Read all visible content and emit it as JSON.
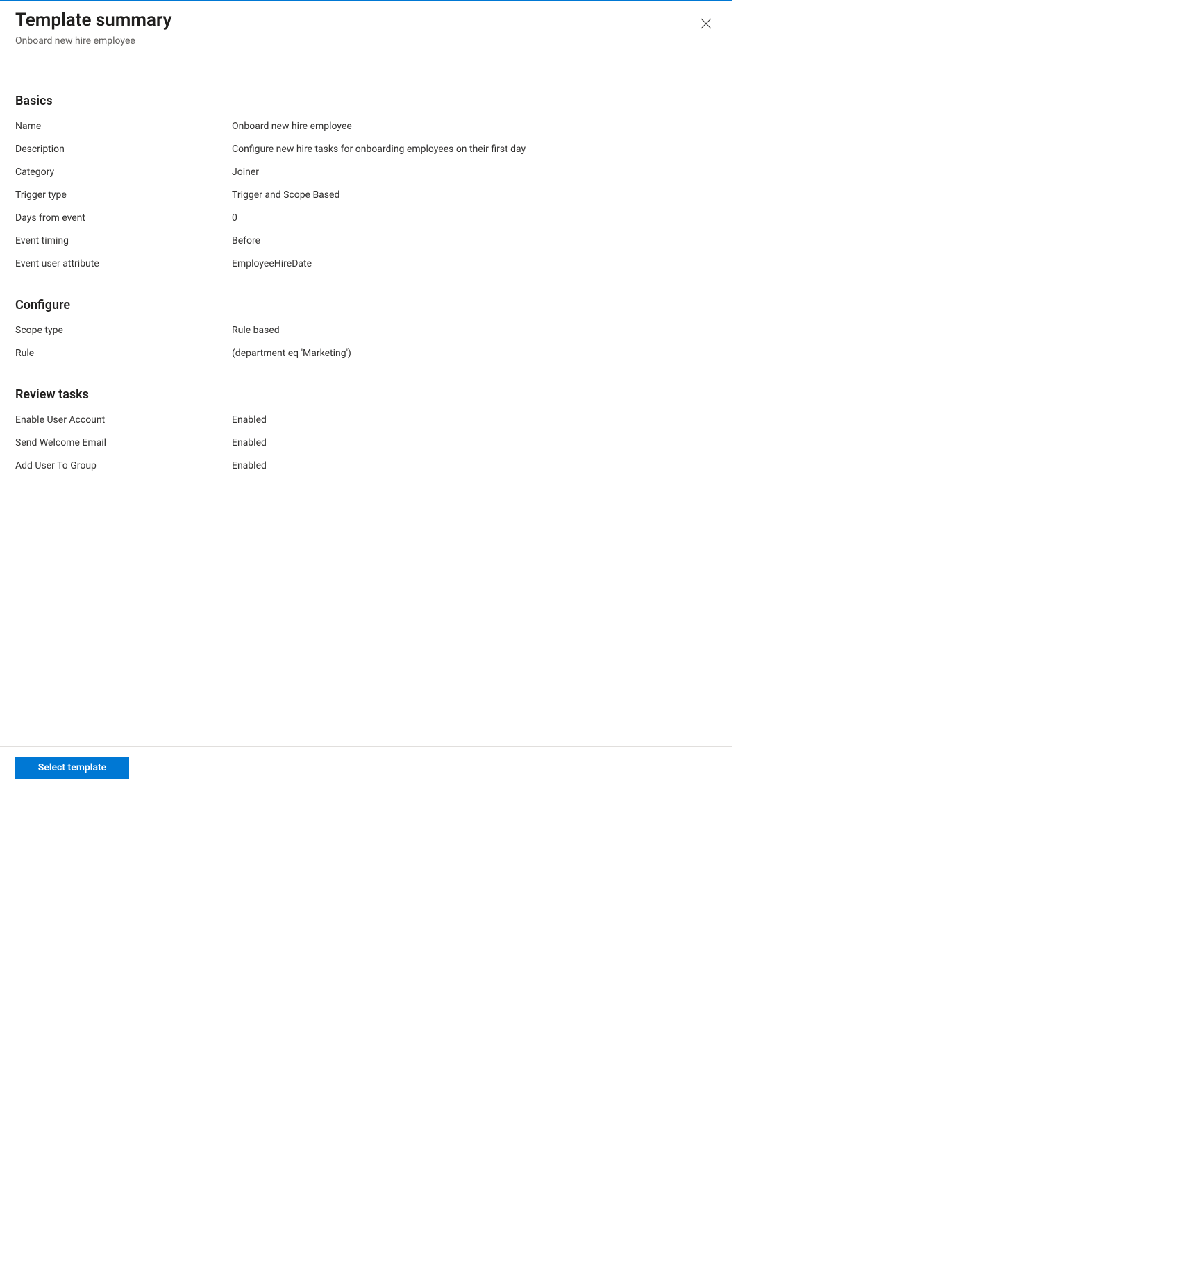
{
  "header": {
    "title": "Template summary",
    "subtitle": "Onboard new hire employee"
  },
  "sections": {
    "basics": {
      "title": "Basics",
      "rows": {
        "name": {
          "label": "Name",
          "value": "Onboard new hire employee"
        },
        "description": {
          "label": "Description",
          "value": "Configure new hire tasks for onboarding employees on their first day"
        },
        "category": {
          "label": "Category",
          "value": "Joiner"
        },
        "trigger_type": {
          "label": "Trigger type",
          "value": "Trigger and Scope Based"
        },
        "days_from_event": {
          "label": "Days from event",
          "value": "0"
        },
        "event_timing": {
          "label": "Event timing",
          "value": "Before"
        },
        "event_user_attribute": {
          "label": "Event user attribute",
          "value": "EmployeeHireDate"
        }
      }
    },
    "configure": {
      "title": "Configure",
      "rows": {
        "scope_type": {
          "label": "Scope type",
          "value": "Rule based"
        },
        "rule": {
          "label": "Rule",
          "value": "(department eq 'Marketing')"
        }
      }
    },
    "review_tasks": {
      "title": "Review tasks",
      "rows": {
        "enable_user_account": {
          "label": "Enable User Account",
          "value": "Enabled"
        },
        "send_welcome_email": {
          "label": "Send Welcome Email",
          "value": "Enabled"
        },
        "add_user_to_group": {
          "label": "Add User To Group",
          "value": "Enabled"
        }
      }
    }
  },
  "footer": {
    "select_template_label": "Select template"
  }
}
